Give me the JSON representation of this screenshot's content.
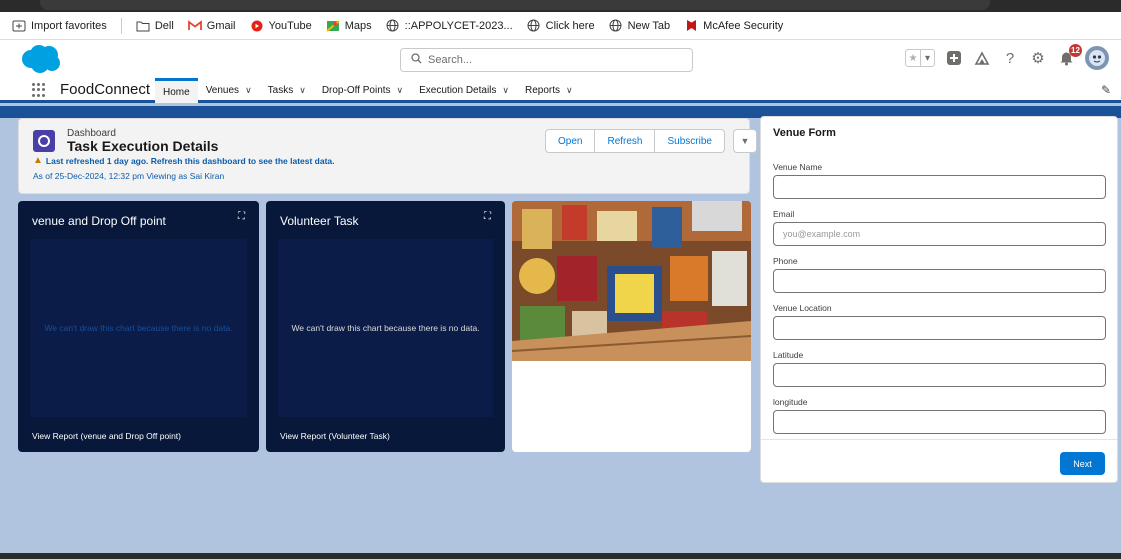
{
  "bookmarks": [
    {
      "label": "Import favorites",
      "icon": "import-icon"
    },
    {
      "label": "Dell",
      "icon": "folder-icon"
    },
    {
      "label": "Gmail",
      "icon": "gmail-icon"
    },
    {
      "label": "YouTube",
      "icon": "youtube-icon"
    },
    {
      "label": "Maps",
      "icon": "maps-icon"
    },
    {
      "label": "::APPOLYCET-2023...",
      "icon": "globe-icon"
    },
    {
      "label": "Click here",
      "icon": "globe-icon"
    },
    {
      "label": "New Tab",
      "icon": "globe-icon"
    },
    {
      "label": "McAfee Security",
      "icon": "mcafee-icon"
    }
  ],
  "header": {
    "search_placeholder": "Search...",
    "notification_count": "12"
  },
  "nav": {
    "app_name": "FoodConnect",
    "items": [
      {
        "label": "Home",
        "active": true
      },
      {
        "label": "Venues"
      },
      {
        "label": "Tasks"
      },
      {
        "label": "Drop-Off Points"
      },
      {
        "label": "Execution Details"
      },
      {
        "label": "Reports"
      }
    ]
  },
  "dashboard": {
    "kicker": "Dashboard",
    "title": "Task Execution Details",
    "warning": "Last refreshed 1 day ago. Refresh this dashboard to see the latest data.",
    "as_of": "As of 25-Dec-2024, 12:32 pm Viewing as Sai Kiran",
    "buttons": {
      "open": "Open",
      "refresh": "Refresh",
      "subscribe": "Subscribe"
    }
  },
  "widgets": [
    {
      "title": "venue and Drop Off point",
      "message": "We can't draw this chart because there is no data.",
      "link": "View Report (venue and Drop Off point)",
      "message_color": "#1a4f99"
    },
    {
      "title": "Volunteer Task",
      "message": "We can't draw this chart because there is no data.",
      "link": "View Report (Volunteer Task)",
      "message_color": "#dcdcdc"
    }
  ],
  "form": {
    "title": "Venue Form",
    "fields": [
      {
        "label": "Venue Name",
        "placeholder": ""
      },
      {
        "label": "Email",
        "placeholder": "you@example.com"
      },
      {
        "label": "Phone",
        "placeholder": ""
      },
      {
        "label": "Venue Location",
        "placeholder": ""
      },
      {
        "label": "Latitude",
        "placeholder": ""
      },
      {
        "label": "longitude",
        "placeholder": ""
      }
    ],
    "next_label": "Next"
  },
  "colors": {
    "brand_blue": "#0176d3",
    "widget_bg": "#07183b",
    "page_bg": "#b0c4df"
  }
}
